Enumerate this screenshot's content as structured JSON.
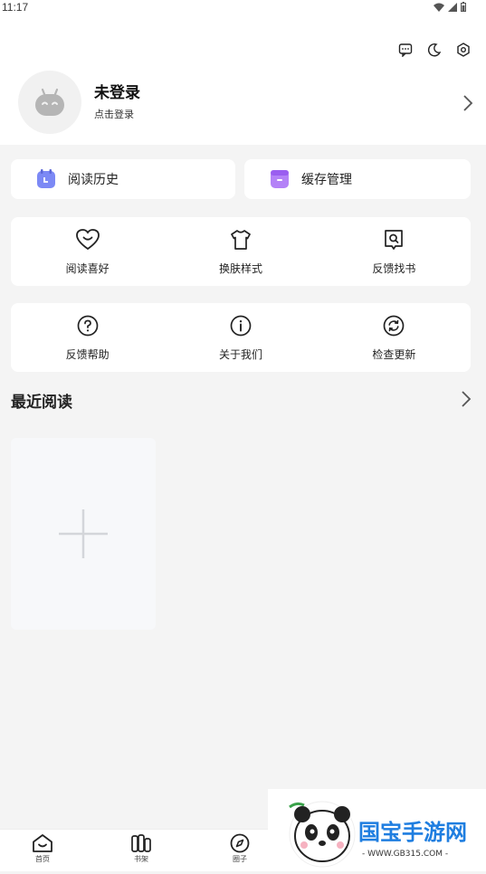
{
  "status_bar": {
    "time": "11:17"
  },
  "top_actions": {
    "icons": [
      "message-icon",
      "moon-icon",
      "settings-icon"
    ]
  },
  "profile": {
    "name": "未登录",
    "subtitle": "点击登录"
  },
  "quick_actions": [
    {
      "label": "阅读历史",
      "icon": "clock-calendar-icon",
      "color": "#6f7cf0"
    },
    {
      "label": "缓存管理",
      "icon": "box-icon",
      "color": "#a068f2"
    }
  ],
  "grid_row_1": [
    {
      "label": "阅读喜好",
      "icon": "heart-smile-icon"
    },
    {
      "label": "换肤样式",
      "icon": "tshirt-icon"
    },
    {
      "label": "反馈找书",
      "icon": "book-search-icon"
    }
  ],
  "grid_row_2": [
    {
      "label": "反馈帮助",
      "icon": "question-icon"
    },
    {
      "label": "关于我们",
      "icon": "info-icon"
    },
    {
      "label": "检查更新",
      "icon": "refresh-icon"
    }
  ],
  "recent": {
    "title": "最近阅读"
  },
  "bottom_nav": [
    {
      "label": "首页",
      "icon": "home-icon"
    },
    {
      "label": "书架",
      "icon": "bookshelf-icon"
    },
    {
      "label": "圈子",
      "icon": "compass-icon"
    }
  ],
  "watermark": {
    "brand": "国宝手游网",
    "url": "- WWW.GB315.COM -"
  }
}
